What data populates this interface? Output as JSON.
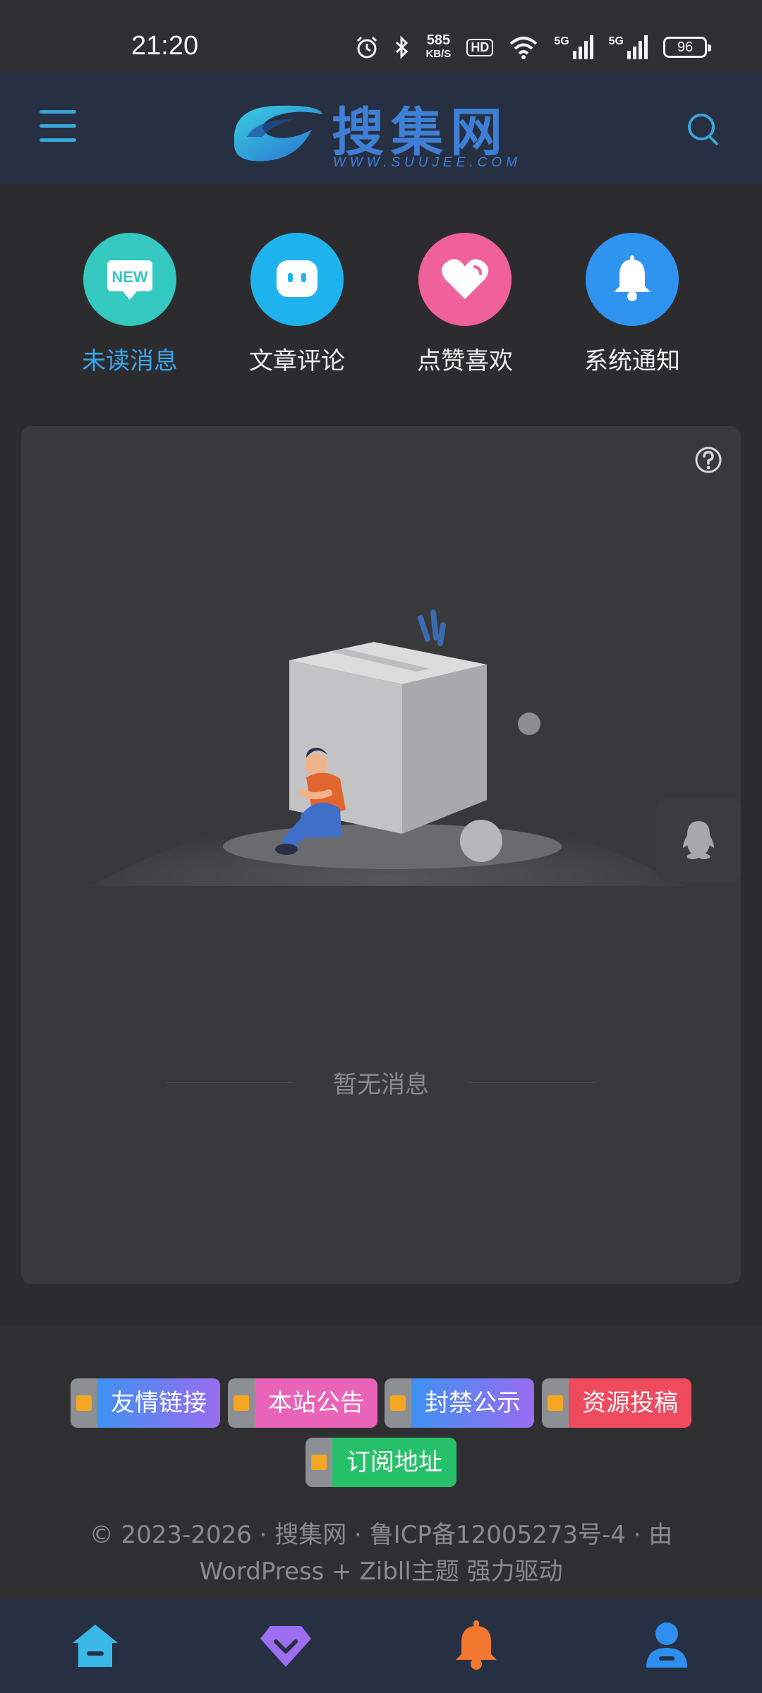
{
  "status_bar": {
    "time": "21:20",
    "net_speed_value": "585",
    "net_speed_unit": "KB/S",
    "hd_label": "HD",
    "signal_5g_1": "5G",
    "signal_5g_2": "5G",
    "battery": "96"
  },
  "header": {
    "logo_text": "搜集网",
    "logo_sub": "WWW.SUUJEE.COM",
    "accent_color": "#3aa3d8"
  },
  "quick_nav": [
    {
      "label": "未读消息",
      "icon": "new-badge-icon",
      "active": true,
      "color": "#34c9c0"
    },
    {
      "label": "文章评论",
      "icon": "comment-bubble-icon",
      "active": false,
      "color": "#1fb3ee"
    },
    {
      "label": "点赞喜欢",
      "icon": "heart-icon",
      "active": false,
      "color": "#f0609a"
    },
    {
      "label": "系统通知",
      "icon": "bell-icon",
      "active": false,
      "color": "#2f93f0"
    }
  ],
  "empty_state": {
    "text": "暂无消息",
    "help_icon": "question-circle-icon",
    "illustration": "empty-box-illustration"
  },
  "float_button": {
    "icon": "qq-penguin-icon"
  },
  "footer": {
    "tags": [
      {
        "label": "友情链接",
        "color_start": "#3f92f2",
        "color_end": "#9a6cf0"
      },
      {
        "label": "本站公告",
        "color_start": "#e963b8",
        "color_end": "#e963b8"
      },
      {
        "label": "封禁公示",
        "color_start": "#3f92f2",
        "color_end": "#9a6cf0"
      },
      {
        "label": "资源投稿",
        "color_start": "#ef4a5e",
        "color_end": "#ef4a5e"
      },
      {
        "label": "订阅地址",
        "color_start": "#27c06a",
        "color_end": "#27c06a"
      }
    ],
    "copyright_line1": "© 2023-2026 · 搜集网 · 鲁ICP备12005273号-4 · 由",
    "copyright_line2": "WordPress + Zibll主题 强力驱动"
  },
  "tab_bar": [
    {
      "icon": "home-icon",
      "color": "#3ab8e8"
    },
    {
      "icon": "diamond-vip-icon",
      "color": "#9b6ef2"
    },
    {
      "icon": "bell-icon",
      "color": "#f3782f"
    },
    {
      "icon": "user-icon",
      "color": "#2f8ff0"
    }
  ]
}
